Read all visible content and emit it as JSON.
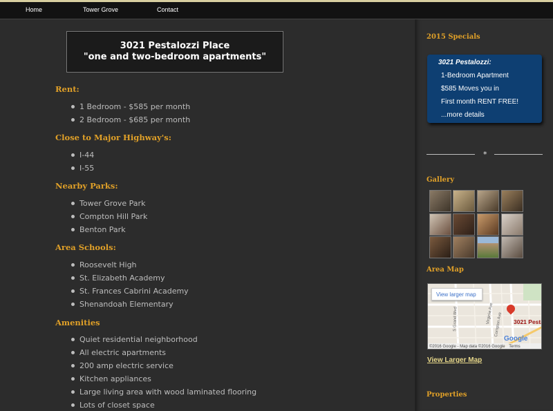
{
  "nav": {
    "items": [
      "Home",
      "Tower Grove",
      "Contact"
    ]
  },
  "main": {
    "title_line1": "3021 Pestalozzi Place",
    "title_line2": "\"one and two-bedroom apartments\"",
    "sections": [
      {
        "title": "Rent:",
        "items": [
          "1 Bedroom - $585 per month",
          "2 Bedroom - $685 per month"
        ]
      },
      {
        "title": "Close to Major Highway's:",
        "items": [
          "I-44",
          "I-55"
        ]
      },
      {
        "title": "Nearby Parks:",
        "items": [
          "Tower Grove Park",
          "Compton Hill Park",
          "Benton Park"
        ]
      },
      {
        "title": "Area Schools:",
        "items": [
          "Roosevelt High",
          "St. Elizabeth Academy",
          "St. Frances Cabrini Academy",
          "Shenandoah Elementary"
        ]
      },
      {
        "title": "Amenities",
        "items": [
          "Quiet residential neighborhood",
          "All electric apartments",
          "200 amp electric service",
          "Kitchen appliances",
          "Large living area with wood laminated flooring",
          "Lots of closet space"
        ]
      }
    ]
  },
  "sidebar": {
    "specials_title": "2015 Specials",
    "specials": {
      "heading": "3021 Pestalozzi:",
      "line1": "1-Bedroom Apartment",
      "line2": "$585 Moves you in",
      "line3": "First month RENT FREE!",
      "more": "...more details"
    },
    "divider_symbol": "*",
    "gallery_title": "Gallery",
    "map_title": "Area Map",
    "map_button": "View larger map",
    "map_pin_label": "3021 Pestal",
    "map_streets": [
      "S Grand Blvd",
      "Virginia Ave",
      "Compton Ave"
    ],
    "map_footer": "©2016 Google - Map data ©2016 Google",
    "map_terms": "Terms",
    "map_brand": "Google",
    "view_larger_map": "View Larger Map",
    "properties_title": "Properties"
  },
  "colors": {
    "accent": "#e0a028",
    "specials_bg": "#0e3f72",
    "background": "#2a2a2a"
  }
}
